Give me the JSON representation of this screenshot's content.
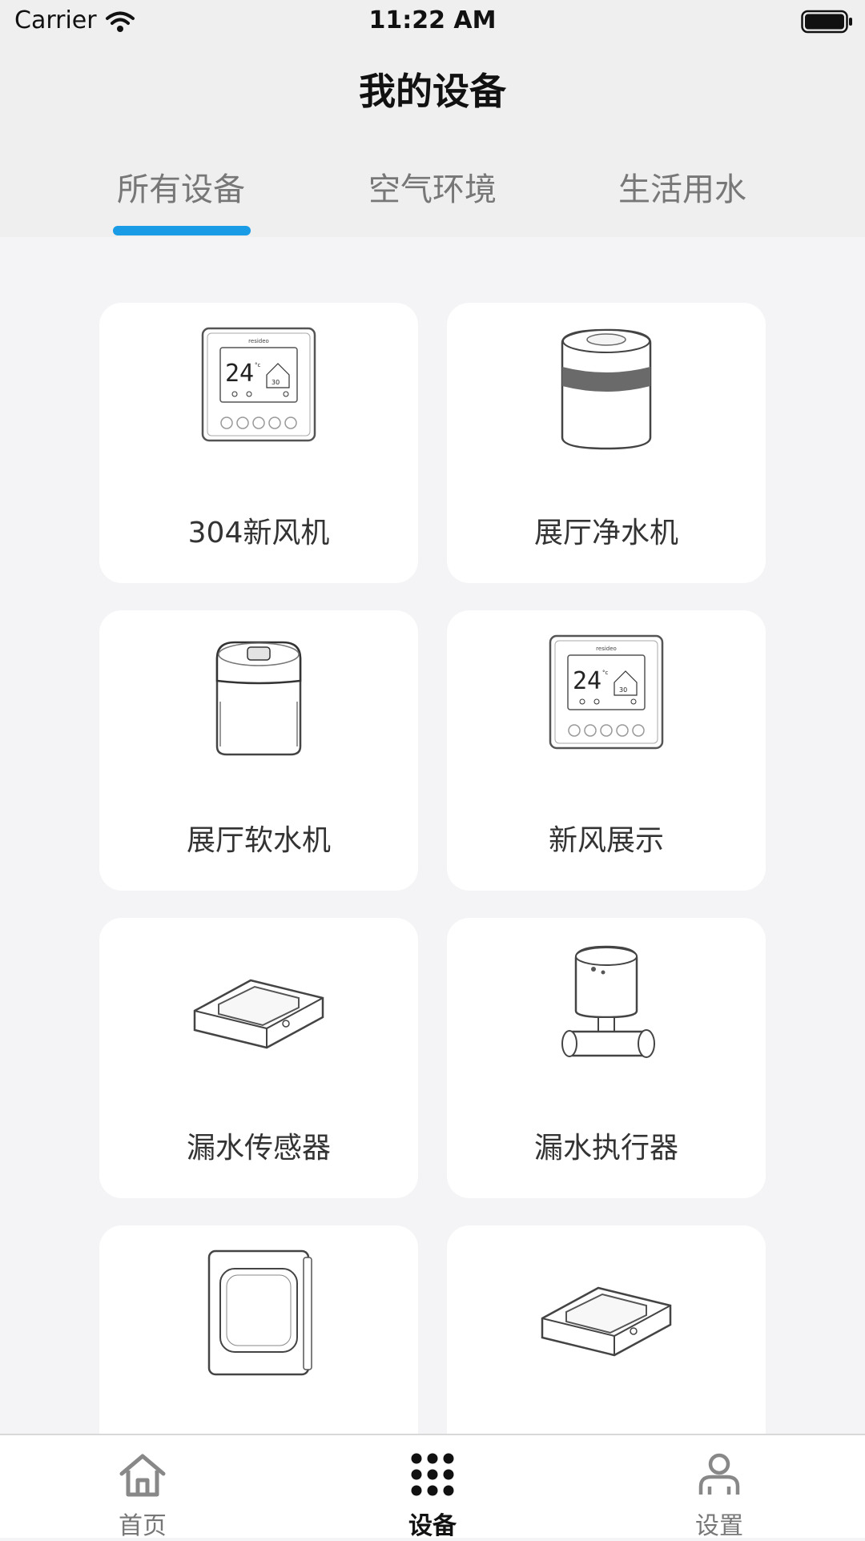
{
  "status_bar": {
    "carrier": "Carrier",
    "time": "11:22 AM"
  },
  "header": {
    "title": "我的设备"
  },
  "tabs": [
    {
      "label": "所有设备",
      "active": true
    },
    {
      "label": "空气环境",
      "active": false
    },
    {
      "label": "生活用水",
      "active": false
    }
  ],
  "accent_color": "#1a9be6",
  "devices": [
    {
      "name": "304新风机",
      "icon": "thermostat-panel-icon"
    },
    {
      "name": "展厅净水机",
      "icon": "water-purifier-icon"
    },
    {
      "name": "展厅软水机",
      "icon": "water-softener-icon"
    },
    {
      "name": "新风展示",
      "icon": "thermostat-panel-icon"
    },
    {
      "name": "漏水传感器",
      "icon": "leak-sensor-icon"
    },
    {
      "name": "漏水执行器",
      "icon": "valve-actuator-icon"
    },
    {
      "name": "",
      "icon": "wall-panel-icon"
    },
    {
      "name": "",
      "icon": "leak-sensor-icon"
    }
  ],
  "thermostat_display": {
    "brand": "resideo",
    "temperature": "24",
    "unit": "°c",
    "humidity": "30"
  },
  "bottom_tabs": [
    {
      "label": "首页",
      "icon": "home-icon",
      "active": false
    },
    {
      "label": "设备",
      "icon": "grid-dots-icon",
      "active": true
    },
    {
      "label": "设置",
      "icon": "person-icon",
      "active": false
    }
  ]
}
